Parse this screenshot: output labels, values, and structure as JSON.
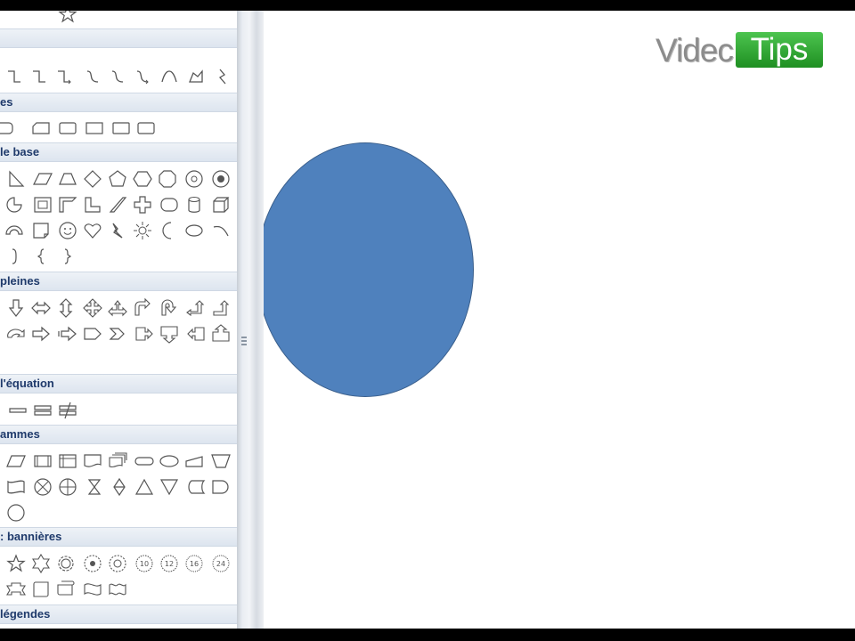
{
  "gallery": {
    "categories": [
      {
        "label": "es"
      },
      {
        "label": "le base"
      },
      {
        "label": "pleines"
      },
      {
        "label": "l'équation"
      },
      {
        "label": "ammes"
      },
      {
        "label": ": bannières"
      },
      {
        "label": "légendes"
      }
    ]
  },
  "canvas": {
    "shape": {
      "type": "circle",
      "fill": "#4f81bd",
      "stroke": "#3a5f8c"
    }
  },
  "watermark": {
    "part1": "Videc",
    "part2": "Tips"
  },
  "colors": {
    "category_text": "#1f3a6b",
    "shape_fill": "#4f81bd",
    "logo_green": "#2ea831"
  }
}
